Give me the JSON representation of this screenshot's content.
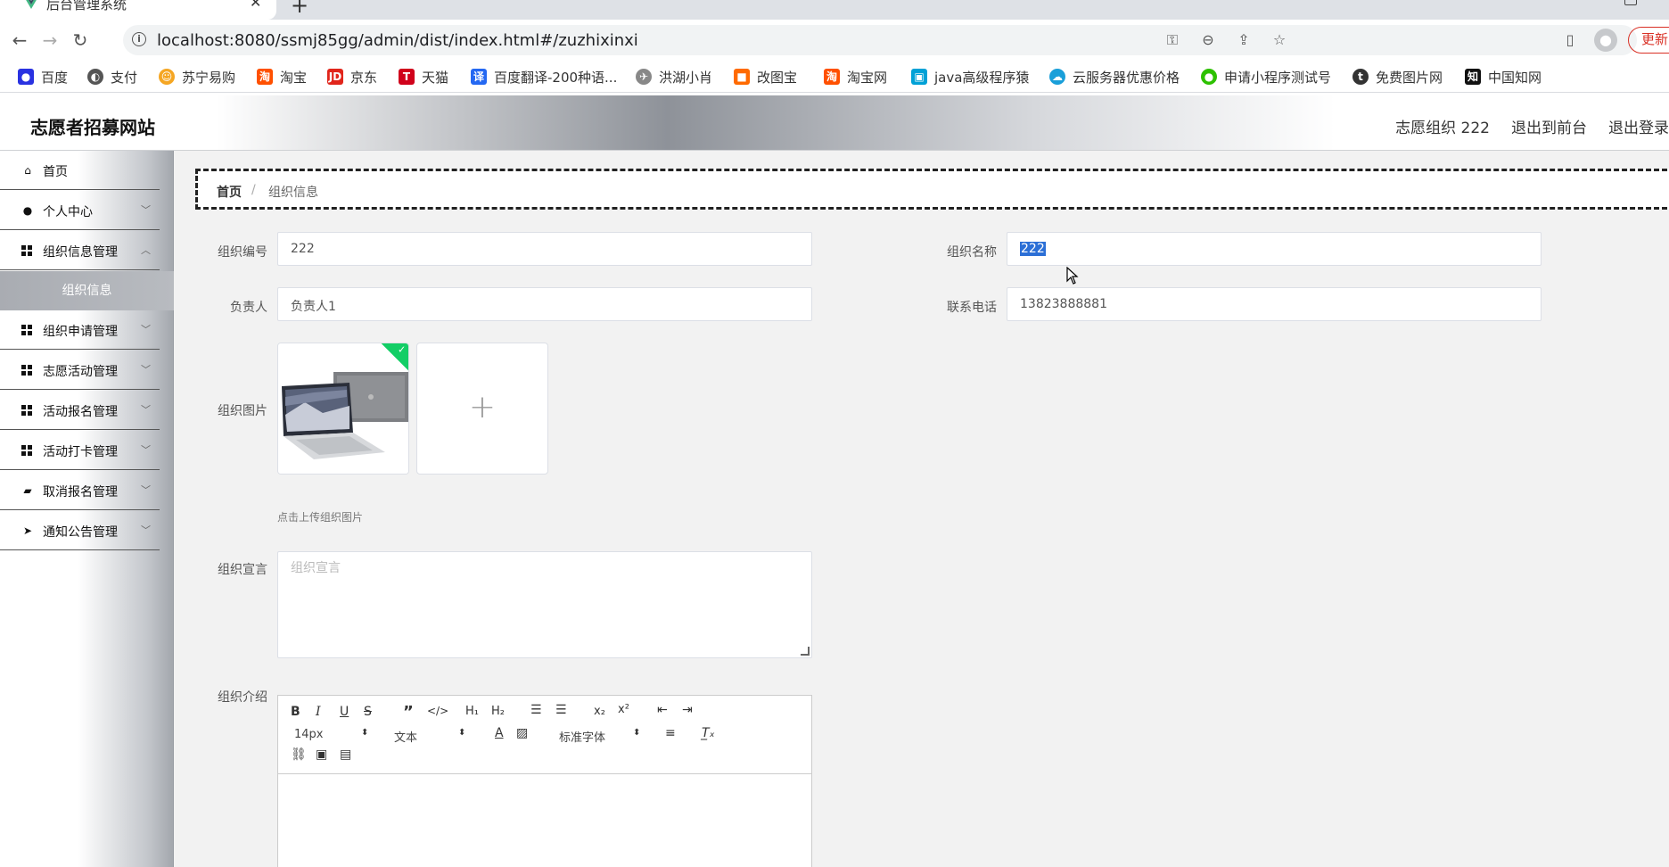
{
  "browser": {
    "tab_title": "后台管理系统",
    "url": "localhost:8080/ssmj85gg/admin/dist/index.html#/zuzhixinxi",
    "update_label": "更新",
    "bookmarks": [
      {
        "label": "百度",
        "icon": "baidu-icon",
        "color": "#2932e1"
      },
      {
        "label": "支付",
        "icon": "globe-icon",
        "color": "#555555"
      },
      {
        "label": "苏宁易购",
        "icon": "suning-icon",
        "color": "#f5a623"
      },
      {
        "label": "淘宝",
        "icon": "taobao-icon",
        "color": "#ff5000"
      },
      {
        "label": "京东",
        "icon": "jd-icon",
        "color": "#e1251b"
      },
      {
        "label": "天猫",
        "icon": "tmall-icon",
        "color": "#d0021b"
      },
      {
        "label": "百度翻译-200种语...",
        "icon": "translate-icon",
        "color": "#2468f2"
      },
      {
        "label": "洪湖小肖",
        "icon": "bird-icon",
        "color": "#666666"
      },
      {
        "label": "改图宝",
        "icon": "gaitubao-icon",
        "color": "#ff6a00"
      },
      {
        "label": "淘宝网",
        "icon": "taobao-icon",
        "color": "#ff5000"
      },
      {
        "label": "java高级程序猿",
        "icon": "bilibili-icon",
        "color": "#00a1d6"
      },
      {
        "label": "云服务器优惠价格",
        "icon": "cloud-icon",
        "color": "#1a9fd9"
      },
      {
        "label": "申请小程序测试号",
        "icon": "wechat-icon",
        "color": "#2dc100"
      },
      {
        "label": "免费图片网",
        "icon": "t-icon",
        "color": "#333333"
      },
      {
        "label": "中国知网",
        "icon": "cnki-icon",
        "color": "#111111"
      }
    ]
  },
  "header": {
    "title": "志愿者招募网站",
    "user": "志愿组织 222",
    "to_front": "退出到前台",
    "logout": "退出登录"
  },
  "sidebar": {
    "items": [
      {
        "label": "首页",
        "icon": "home-icon"
      },
      {
        "label": "个人中心",
        "icon": "user-icon"
      },
      {
        "label": "组织信息管理",
        "icon": "grid-icon"
      },
      {
        "label": "组织信息",
        "icon": ""
      },
      {
        "label": "组织申请管理",
        "icon": "grid-icon"
      },
      {
        "label": "志愿活动管理",
        "icon": "grid-icon"
      },
      {
        "label": "活动报名管理",
        "icon": "grid-icon"
      },
      {
        "label": "活动打卡管理",
        "icon": "grid-icon"
      },
      {
        "label": "取消报名管理",
        "icon": "wallet-icon"
      },
      {
        "label": "通知公告管理",
        "icon": "send-icon"
      }
    ]
  },
  "breadcrumb": {
    "home": "首页",
    "separator": "/",
    "current": "组织信息"
  },
  "form": {
    "org_no_label": "组织编号",
    "org_no_value": "222",
    "org_name_label": "组织名称",
    "org_name_value": "222",
    "leader_label": "负责人",
    "leader_value": "负责人1",
    "phone_label": "联系电话",
    "phone_value": "13823888881",
    "image_label": "组织图片",
    "image_tip": "点击上传组织图片",
    "slogan_label": "组织宣言",
    "slogan_placeholder": "组织宣言",
    "intro_label": "组织介绍"
  },
  "editor": {
    "font_size": "14px",
    "text_type": "文本",
    "font_family": "标准字体"
  },
  "colors": {
    "selection": "#2b6fd6",
    "upload_success": "#13ce66",
    "update_button": "#d93025"
  }
}
